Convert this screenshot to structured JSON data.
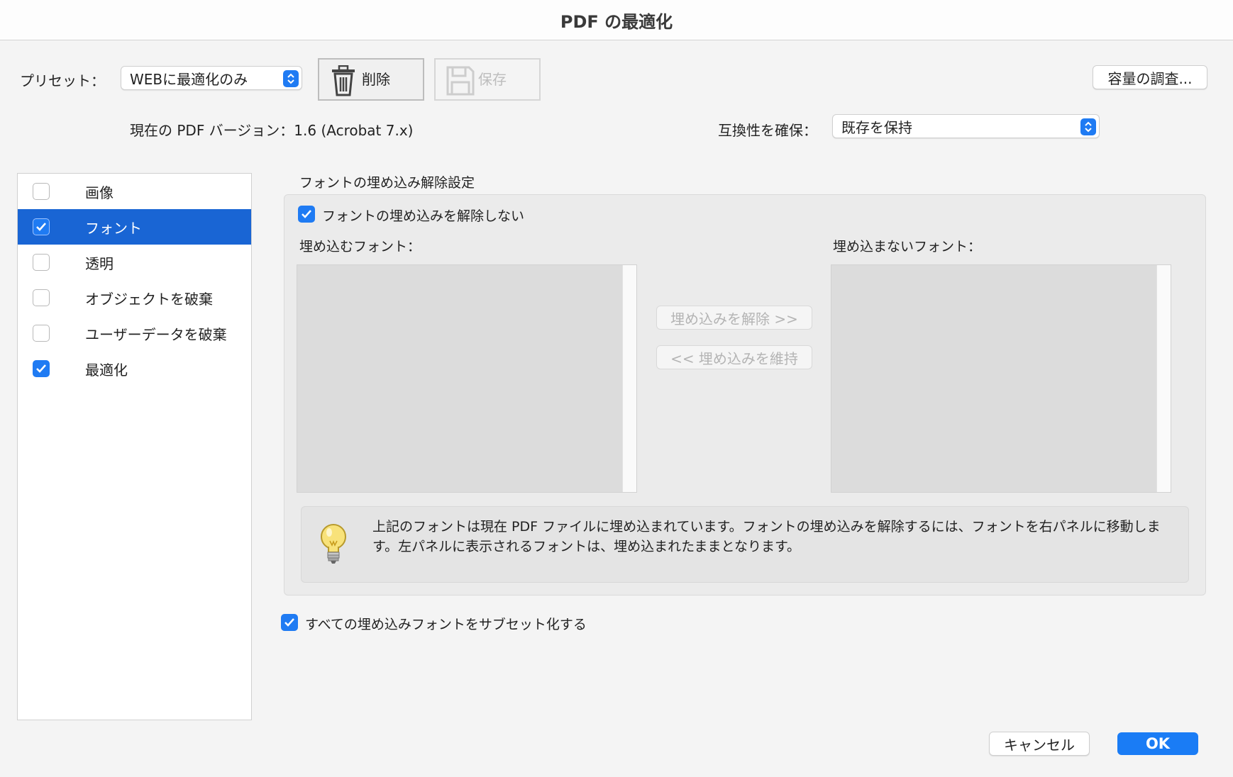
{
  "window": {
    "title": "PDF の最適化"
  },
  "toolbar": {
    "preset_label": "プリセット：",
    "preset_value": "WEBに最適化のみ",
    "delete_label": "削除",
    "save_label": "保存",
    "audit_label": "容量の調査..."
  },
  "version": {
    "current_label": "現在の PDF バージョン：1.6 (Acrobat 7.x)",
    "compat_label": "互換性を確保：",
    "compat_value": "既存を保持"
  },
  "sidebar": {
    "items": [
      {
        "label": "画像",
        "checked": false,
        "selected": false
      },
      {
        "label": "フォント",
        "checked": true,
        "selected": true
      },
      {
        "label": "透明",
        "checked": false,
        "selected": false
      },
      {
        "label": "オブジェクトを破棄",
        "checked": false,
        "selected": false
      },
      {
        "label": "ユーザーデータを破棄",
        "checked": false,
        "selected": false
      },
      {
        "label": "最適化",
        "checked": true,
        "selected": false
      }
    ]
  },
  "fonts": {
    "section_title": "フォントの埋め込み解除設定",
    "no_unembed_label": "フォントの埋め込みを解除しない",
    "no_unembed_checked": true,
    "embedded_header": "埋め込むフォント：",
    "unembedded_header": "埋め込まないフォント：",
    "unembed_button": "埋め込みを解除 >>",
    "keep_button": "<< 埋め込みを維持",
    "info_text": "上記のフォントは現在 PDF ファイルに埋め込まれています。フォントの埋め込みを解除するには、フォントを右パネルに移動します。左パネルに表示されるフォントは、埋め込まれたままとなります。",
    "subset_label": "すべての埋め込みフォントをサブセット化する",
    "subset_checked": true
  },
  "footer": {
    "cancel_label": "キャンセル",
    "ok_label": "OK"
  },
  "colors": {
    "accent": "#1f7bf3",
    "selection": "#1965d4"
  }
}
